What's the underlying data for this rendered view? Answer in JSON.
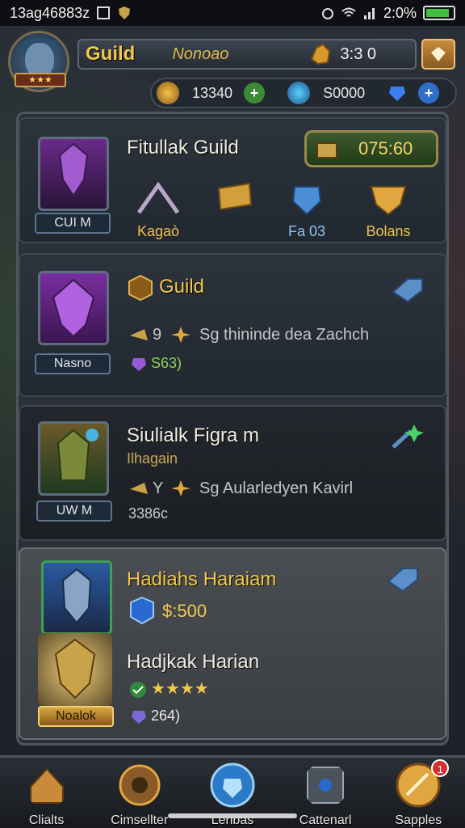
{
  "status_bar": {
    "time": "13ag46883z",
    "right_text": "2:0%"
  },
  "header": {
    "guild_title": "Guild",
    "guild_sub": "Nonoao",
    "gold_value": "3:3 0",
    "currency_1": "13340",
    "currency_2": "S0000",
    "avatar_stars": "★★★"
  },
  "cards": [
    {
      "title": "Fitullak Guild",
      "portrait_label": "CUI M",
      "amount": "075:60",
      "rewards": [
        {
          "label": "Kagaò"
        },
        {
          "label": ""
        },
        {
          "label": "Fa 03"
        },
        {
          "label": "Bolans"
        }
      ]
    },
    {
      "title": "Guild",
      "portrait_label": "Nasno",
      "line": "Sg thininde dea Zachch",
      "line_prefix": "9",
      "value": "S63)"
    },
    {
      "title": "Siulialk Figra m",
      "sub": "Ilhagain",
      "portrait_label": "UW M",
      "line": "Sg Aularledyen Kavirl",
      "line_prefix": "Y",
      "value": "3386c"
    },
    {
      "title": "Hadiahs Haraiam",
      "value": "$:500",
      "title2": "Hadjkak Harian",
      "stars": "★★★★",
      "value2": "264)",
      "portrait_label2": "Noalok"
    }
  ],
  "nav": [
    {
      "label": "Clialts"
    },
    {
      "label": "Cimsellter"
    },
    {
      "label": "Lenbas"
    },
    {
      "label": "Cattenarl"
    },
    {
      "label": "Sapples"
    }
  ],
  "colors": {
    "accent_gold": "#f2c94c",
    "panel": "#2b3139",
    "positive": "#3ec13e"
  }
}
